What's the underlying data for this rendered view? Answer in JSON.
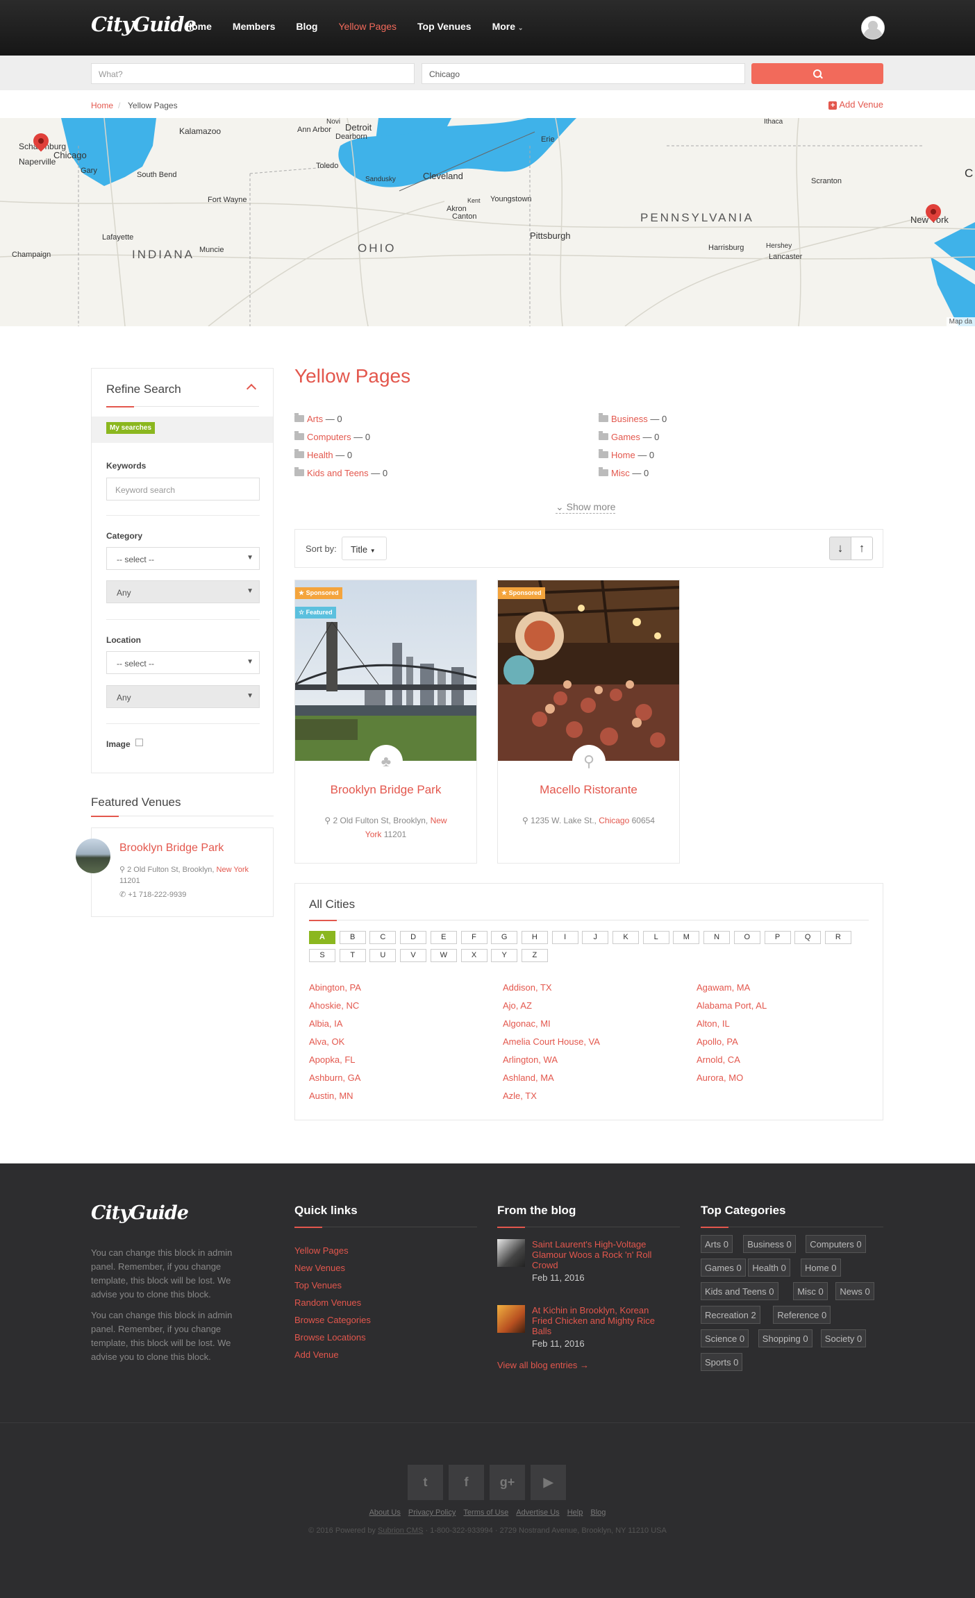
{
  "header": {
    "logo": "CityGuide",
    "nav": [
      {
        "label": "Home",
        "active": false
      },
      {
        "label": "Members",
        "active": false
      },
      {
        "label": "Blog",
        "active": false
      },
      {
        "label": "Yellow Pages",
        "active": true
      },
      {
        "label": "Top Venues",
        "active": false
      },
      {
        "label": "More",
        "active": false,
        "dropdown": true
      }
    ]
  },
  "search": {
    "what_placeholder": "What?",
    "where_value": "Chicago",
    "button_icon": "search-icon"
  },
  "breadcrumb": {
    "home": "Home",
    "separator": "/",
    "current": "Yellow Pages"
  },
  "add_venue_label": "Add Venue",
  "map": {
    "labels": {
      "schaumburg": "Schaumburg",
      "chicago": "Chicago",
      "naperville": "Naperville",
      "gary": "Gary",
      "south_bend": "South Bend",
      "kalamazoo": "Kalamazoo",
      "ann_arbor": "Ann Arbor",
      "detroit": "Detroit",
      "dearborn": "Dearborn",
      "novi": "Novi",
      "toledo": "Toledo",
      "sandusky": "Sandusky",
      "cleveland": "Cleveland",
      "erie": "Erie",
      "ithaca": "Ithaca",
      "akron": "Akron",
      "kent": "Kent",
      "youngstown": "Youngstown",
      "canton": "Canton",
      "fort_wayne": "Fort Wayne",
      "lafayette": "Lafayette",
      "champaign": "Champaign",
      "indiana": "INDIANA",
      "muncie": "Muncie",
      "ohio": "OHIO",
      "pittsburgh": "Pittsburgh",
      "pennsylvania": "PENNSYLVANIA",
      "scranton": "Scranton",
      "harrisburg": "Harrisburg",
      "hershey": "Hershey",
      "lancaster": "Lancaster",
      "new_york": "New York",
      "edge_c": "C"
    },
    "credit": "Map da"
  },
  "refine": {
    "title": "Refine Search",
    "my_searches": "My searches",
    "keywords_label": "Keywords",
    "keywords_placeholder": "Keyword search",
    "category_label": "Category",
    "category_select": "-- select --",
    "category_sub": "Any",
    "location_label": "Location",
    "location_select": "-- select --",
    "location_sub": "Any",
    "image_label": "Image"
  },
  "featured": {
    "title": "Featured Venues",
    "name": "Brooklyn Bridge Park",
    "addr_pre": "2 Old Fulton St, Brooklyn,",
    "addr_city": "New York",
    "addr_zip": "11201",
    "phone": "+1 718-222-9939"
  },
  "yellow_pages": {
    "title": "Yellow Pages",
    "categories_left": [
      {
        "name": "Arts",
        "count": "— 0"
      },
      {
        "name": "Computers",
        "count": "— 0"
      },
      {
        "name": "Health",
        "count": "— 0"
      },
      {
        "name": "Kids and Teens",
        "count": "— 0"
      }
    ],
    "categories_right": [
      {
        "name": "Business",
        "count": "— 0"
      },
      {
        "name": "Games",
        "count": "— 0"
      },
      {
        "name": "Home",
        "count": "— 0"
      },
      {
        "name": "Misc",
        "count": "— 0"
      }
    ],
    "show_more": "Show more"
  },
  "sort": {
    "label": "Sort by:",
    "value": "Title",
    "desc_icon": "↓",
    "asc_icon": "↑"
  },
  "listings": [
    {
      "name": "Brooklyn Bridge Park",
      "badge_sponsored": "Sponsored",
      "badge_featured": "Featured",
      "addr_pre": "2 Old Fulton St, Brooklyn,",
      "addr_city": "New York",
      "addr_zip": "11201",
      "icon": "park-icon"
    },
    {
      "name": "Macello Ristorante",
      "badge_sponsored": "Sponsored",
      "addr_pre": "1235 W. Lake St.,",
      "addr_city": "Chicago",
      "addr_zip": "60654",
      "icon": "restaurant-icon"
    }
  ],
  "cities": {
    "title": "All Cities",
    "letters": [
      "A",
      "B",
      "C",
      "D",
      "E",
      "F",
      "G",
      "H",
      "I",
      "J",
      "K",
      "L",
      "M",
      "N",
      "O",
      "P",
      "Q",
      "R",
      "S",
      "T",
      "U",
      "V",
      "W",
      "X",
      "Y",
      "Z"
    ],
    "active_letter": "A",
    "col1": [
      "Abington, PA",
      "Ahoskie, NC",
      "Albia, IA",
      "Alva, OK",
      "Apopka, FL",
      "Ashburn, GA",
      "Austin, MN"
    ],
    "col2": [
      "Addison, TX",
      "Ajo, AZ",
      "Algonac, MI",
      "Amelia Court House, VA",
      "Arlington, WA",
      "Ashland, MA",
      "Azle, TX"
    ],
    "col3": [
      "Agawam, MA",
      "Alabama Port, AL",
      "Alton, IL",
      "Apollo, PA",
      "Arnold, CA",
      "Aurora, MO"
    ]
  },
  "footer": {
    "logo": "CityGuide",
    "text1": "You can change this block in admin panel. Remember, if you change template, this block will be lost. We advise you to clone this block.",
    "text2": "You can change this block in admin panel. Remember, if you change template, this block will be lost. We advise you to clone this block.",
    "quick_links_title": "Quick links",
    "quick_links": [
      "Yellow Pages",
      "New Venues",
      "Top Venues",
      "Random Venues",
      "Browse Categories",
      "Browse Locations",
      "Add Venue"
    ],
    "blog_title": "From the blog",
    "blog": [
      {
        "title": "Saint Laurent's High-Voltage Glamour Woos a Rock 'n' Roll Crowd",
        "date": "Feb 11, 2016"
      },
      {
        "title": "At Kichin in Brooklyn, Korean Fried Chicken and Mighty Rice Balls",
        "date": "Feb 11, 2016"
      }
    ],
    "blog_all": "View all blog entries →",
    "top_cat_title": "Top Categories",
    "tags": [
      "Arts 0",
      "Business 0",
      "Computers 0",
      "Games 0",
      "Health 0",
      "Home 0",
      "Kids and Teens 0",
      "Misc 0",
      "News 0",
      "Recreation 2",
      "Reference 0",
      "Science 0",
      "Shopping 0",
      "Society 0",
      "Sports 0"
    ],
    "social": [
      "twitter-icon",
      "facebook-icon",
      "google-plus-icon",
      "youtube-icon"
    ],
    "links": [
      "About Us",
      "Privacy Policy",
      "Terms of Use",
      "Advertise Us",
      "Help",
      "Blog"
    ],
    "copy_pre": "© 2016 Powered by",
    "copy_link": "Subrion CMS",
    "copy_post": "· 1-800-322-933994 · 2729 Nostrand Avenue, Brooklyn, NY 11210 USA"
  },
  "colors": {
    "accent": "#e3574d",
    "nav_active": "#f26a5b",
    "search_button": "#f26a5b",
    "green": "#8bb71f",
    "sponsored": "#f4a43c",
    "featured": "#5bc0de",
    "footer_bg": "#2d2d2f",
    "water": "#3fb2e9"
  }
}
